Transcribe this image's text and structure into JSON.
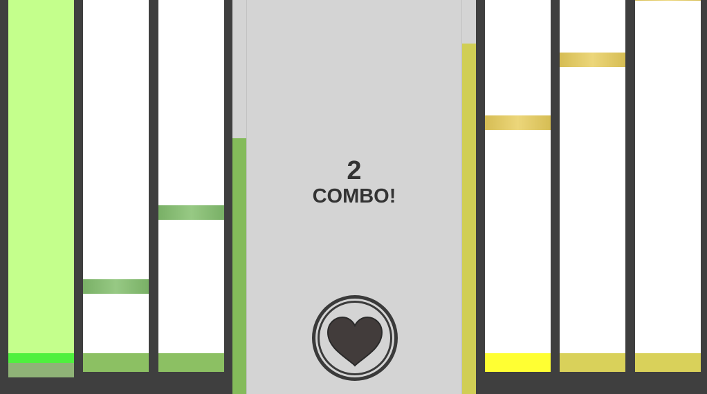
{
  "combo": {
    "count": "2",
    "label": "COMBO!"
  },
  "colors": {
    "background": "#3f3f3f",
    "lane": "#ffffff",
    "lane_active": "#c4ff8c",
    "green_note": "#8cc063",
    "yellow_note": "#d9d15a",
    "center_panel": "#d4d4d4"
  },
  "left_meter": {
    "level": 0.65,
    "color": "green"
  },
  "right_meter": {
    "level": 0.89,
    "color": "yellow"
  },
  "lanes": [
    {
      "side": "left",
      "color": "green",
      "active": true,
      "notes": []
    },
    {
      "side": "left",
      "color": "green",
      "active": false,
      "notes": [
        {
          "position": 0.75
        }
      ]
    },
    {
      "side": "left",
      "color": "green",
      "active": false,
      "notes": [
        {
          "position": 0.55
        }
      ]
    },
    {
      "side": "right",
      "color": "yellow",
      "active": false,
      "notes": [
        {
          "position": 0.31
        }
      ]
    },
    {
      "side": "right",
      "color": "yellow",
      "active": false,
      "notes": [
        {
          "position": 0.14
        }
      ]
    },
    {
      "side": "right",
      "color": "yellow",
      "active": false,
      "notes": [
        {
          "position": 0.0
        }
      ]
    }
  ],
  "heart_button": {
    "icon": "heart-icon"
  }
}
